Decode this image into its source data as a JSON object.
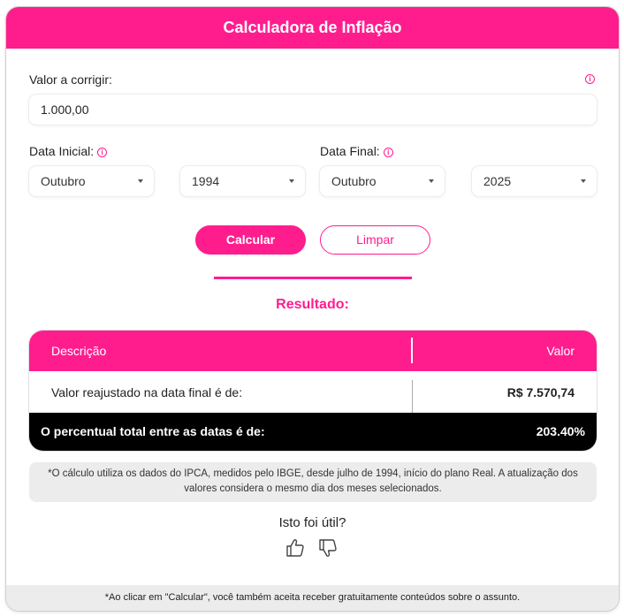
{
  "header": {
    "title": "Calculadora de Inflação"
  },
  "value_field": {
    "label": "Valor a corrigir:",
    "value": "1.000,00"
  },
  "start_date": {
    "label": "Data Inicial:",
    "month": "Outubro",
    "year": "1994"
  },
  "end_date": {
    "label": "Data Final:",
    "month": "Outubro",
    "year": "2025"
  },
  "buttons": {
    "calculate": "Calcular",
    "clear": "Limpar"
  },
  "result": {
    "title": "Resultado:",
    "columns": [
      "Descrição",
      "Valor"
    ],
    "row": {
      "description": "Valor reajustado na data final é de:",
      "value": "R$ 7.570,74"
    },
    "total": {
      "description": "O percentual total entre as datas é de:",
      "value": "203.40%"
    }
  },
  "note": "*O cálculo utiliza os dados do IPCA, medidos pelo IBGE, desde julho de 1994, início do plano Real. A atualização dos valores considera o mesmo dia dos meses selecionados.",
  "feedback": {
    "question": "Isto foi útil?"
  },
  "footer": "*Ao clicar em \"Calcular\", você também aceita receber gratuitamente conteúdos sobre o assunto.",
  "icons": {
    "info": "info-icon",
    "dropdown": "chevron-down-icon",
    "like": "thumbs-up-icon",
    "dislike": "thumbs-down-icon"
  },
  "colors": {
    "accent": "#ff1d8e",
    "total_row": "#000000",
    "note_bg": "#ececec"
  }
}
